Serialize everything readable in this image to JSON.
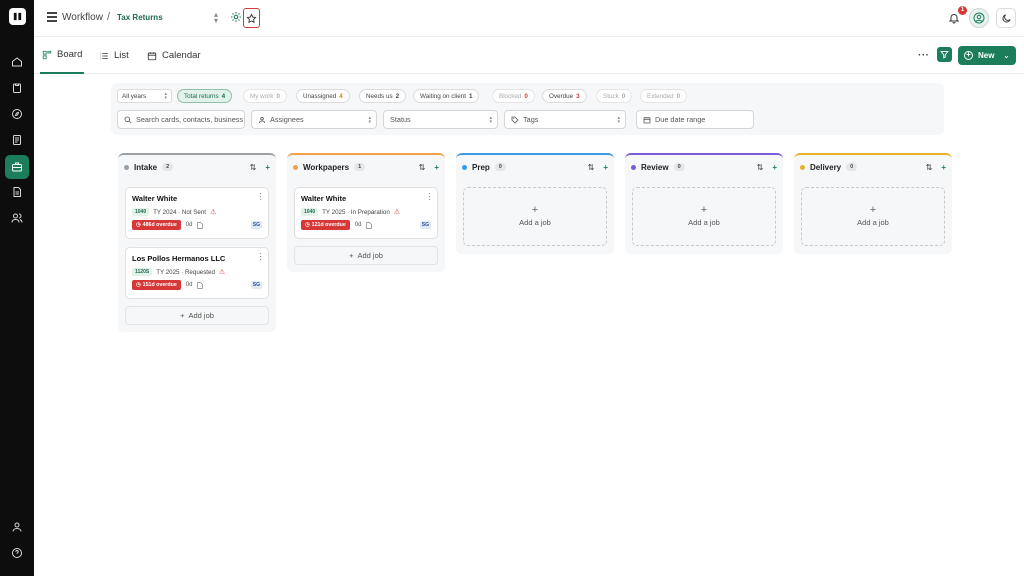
{
  "header": {
    "breadcrumb_root": "Workflow",
    "breadcrumb_sep": "/",
    "breadcrumb_current": "Tax Returns",
    "notification_count": "1"
  },
  "views": {
    "board": "Board",
    "list": "List",
    "calendar": "Calendar",
    "new_label": "New"
  },
  "filters": {
    "year": "All years",
    "chips": [
      {
        "label": "Total returns",
        "count": "4"
      },
      {
        "label": "My work",
        "count": "0"
      },
      {
        "label": "Unassigned",
        "count": "4"
      },
      {
        "label": "Needs us",
        "count": "2"
      },
      {
        "label": "Waiting on client",
        "count": "1"
      },
      {
        "label": "Blocked",
        "count": "0"
      },
      {
        "label": "Overdue",
        "count": "3"
      },
      {
        "label": "Stuck",
        "count": "0"
      },
      {
        "label": "Extended",
        "count": "0"
      }
    ],
    "search_placeholder": "Search cards, contacts, business",
    "assignees": "Assignees",
    "status": "Status",
    "tags": "Tags",
    "due_date": "Due date range"
  },
  "colors": {
    "brand": "#1c7d5b",
    "overdue": "#d63838",
    "intake": "#9aa0a6",
    "workpapers": "#f0a04b",
    "prep": "#3b9ae1",
    "review": "#7c5cd6",
    "delivery": "#e8b32a"
  },
  "columns": [
    {
      "name": "Intake",
      "count": "2",
      "cards": [
        {
          "name": "Walter White",
          "form": "1040",
          "status": "TY 2024 · Not Sent",
          "overdue": "486d overdue",
          "age": "0d",
          "initials": "SG"
        },
        {
          "name": "Los Pollos Hermanos LLC",
          "form": "1120S",
          "status": "TY 2025 · Requested",
          "overdue": "151d overdue",
          "age": "0d",
          "initials": "SG"
        }
      ],
      "add_label": "Add job"
    },
    {
      "name": "Workpapers",
      "count": "1",
      "cards": [
        {
          "name": "Walter White",
          "form": "1040",
          "status": "TY 2025 · In Preparation",
          "overdue": "121d overdue",
          "age": "0d",
          "initials": "SG"
        }
      ],
      "add_label": "Add job"
    },
    {
      "name": "Prep",
      "count": "0",
      "empty_label": "Add a job"
    },
    {
      "name": "Review",
      "count": "0",
      "empty_label": "Add a job"
    },
    {
      "name": "Delivery",
      "count": "0",
      "empty_label": "Add a job"
    }
  ]
}
